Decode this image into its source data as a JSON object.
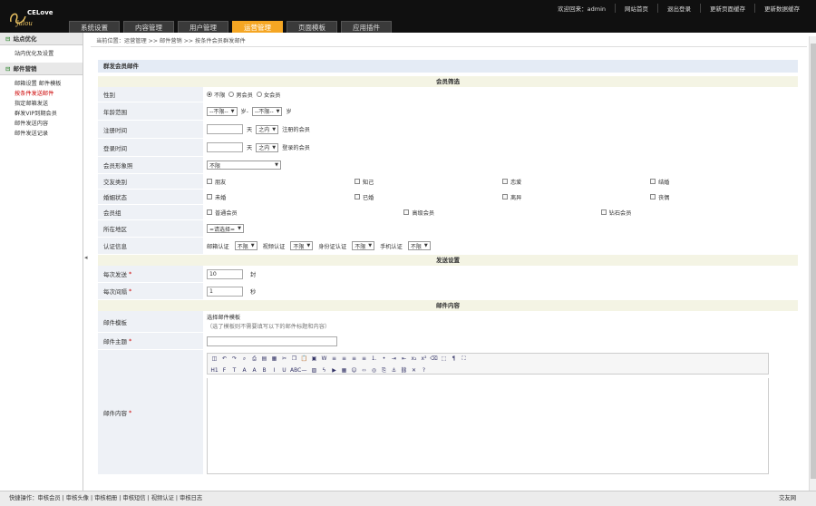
{
  "brand": {
    "logo_text": "CELove",
    "logo_script": "Jalou"
  },
  "toplinks": [
    "欢迎回来：admin",
    "网站首页",
    "退出登录",
    "更新页面缓存",
    "更新数据缓存"
  ],
  "navtabs": [
    {
      "label": "系统设置",
      "active": false
    },
    {
      "label": "内容管理",
      "active": false
    },
    {
      "label": "用户管理",
      "active": false
    },
    {
      "label": "运营管理",
      "active": true
    },
    {
      "label": "页面模板",
      "active": false
    },
    {
      "label": "应用插件",
      "active": false
    }
  ],
  "sidebar": {
    "sections": [
      {
        "title": "站点优化",
        "items": [
          {
            "label": "站内优化及设置",
            "current": false
          }
        ]
      },
      {
        "title": "邮件营销",
        "items": [
          {
            "label": "邮箱设置  邮件模板",
            "current": false
          },
          {
            "label": "按条件发送邮件",
            "current": true
          },
          {
            "label": "指定邮箱发送",
            "current": false
          },
          {
            "label": "群发VIP到期会员",
            "current": false
          },
          {
            "label": "邮件发送内容",
            "current": false
          },
          {
            "label": "邮件发送记录",
            "current": false
          }
        ]
      }
    ]
  },
  "breadcrumb": "当前位置：运营管理 >> 邮件营销 >> 按条件会员群发邮件",
  "page_title": "群发会员邮件",
  "sections": {
    "filter": "会员筛选",
    "send": "发送设置",
    "content": "邮件内容"
  },
  "filter": {
    "gender": {
      "label": "性别",
      "options": [
        "不限",
        "男会员",
        "女会员"
      ],
      "selected": 0
    },
    "age": {
      "label": "年龄范围",
      "from": "--不限--",
      "to_sep": "岁-",
      "to": "--不限--",
      "unit": "岁"
    },
    "regtime": {
      "label": "注册时间",
      "value": "",
      "unit": "天",
      "rel": "之内",
      "suffix": "注册的会员"
    },
    "logintime": {
      "label": "登录时间",
      "value": "",
      "unit": "天",
      "rel": "之内",
      "suffix": "登录的会员"
    },
    "photo": {
      "label": "会员形象照",
      "value": "不限"
    },
    "friend_type": {
      "label": "交友类别",
      "options": [
        "朋友",
        "知己",
        "恋爱",
        "结婚"
      ]
    },
    "marital": {
      "label": "婚姻状态",
      "options": [
        "未婚",
        "已婚",
        "离异",
        "丧偶"
      ]
    },
    "group": {
      "label": "会员组",
      "options": [
        "普通会员",
        "高级会员",
        "钻石会员"
      ]
    },
    "region": {
      "label": "所在地区",
      "value": "=请选择="
    },
    "verify": {
      "label": "认证信息",
      "items": [
        {
          "name": "邮箱认证",
          "value": "不限"
        },
        {
          "name": "视频认证",
          "value": "不限"
        },
        {
          "name": "身份证认证",
          "value": "不限"
        },
        {
          "name": "手机认证",
          "value": "不限"
        }
      ]
    }
  },
  "send": {
    "per_batch": {
      "label": "每次发送",
      "value": "10",
      "unit": "封"
    },
    "interval": {
      "label": "每次间隔",
      "value": "1",
      "unit": "秒"
    }
  },
  "mail": {
    "template": {
      "label": "邮件模板",
      "link": "选择邮件模板",
      "hint": "（选了模板则不需要填写以下的邮件标题和内容）"
    },
    "subject": {
      "label": "邮件主题",
      "value": ""
    },
    "body": {
      "label": "邮件内容"
    }
  },
  "toolbar_row1": [
    "src",
    "undo",
    "redo",
    "find",
    "print",
    "preview",
    "tpl",
    "cut",
    "copy",
    "paste",
    "ptxt",
    "pword",
    "jl",
    "jc",
    "jr",
    "jf",
    "ol",
    "ul",
    "ind",
    "out",
    "sub",
    "sup",
    "clr",
    "sel",
    "fmt",
    "full"
  ],
  "toolbar_row2": [
    "H1",
    "F",
    "T",
    "A",
    "A",
    "B",
    "I",
    "U",
    "ABC",
    "hr",
    "img",
    "flash",
    "media",
    "tbl",
    "emo",
    "code",
    "map",
    "page",
    "anc",
    "link",
    "unlink",
    "about"
  ],
  "footer": {
    "links": "快捷操作：审核会员 | 审核头像 | 审核相册 | 审核短信 | 视频认证 | 审核日志",
    "right": "交友网"
  }
}
